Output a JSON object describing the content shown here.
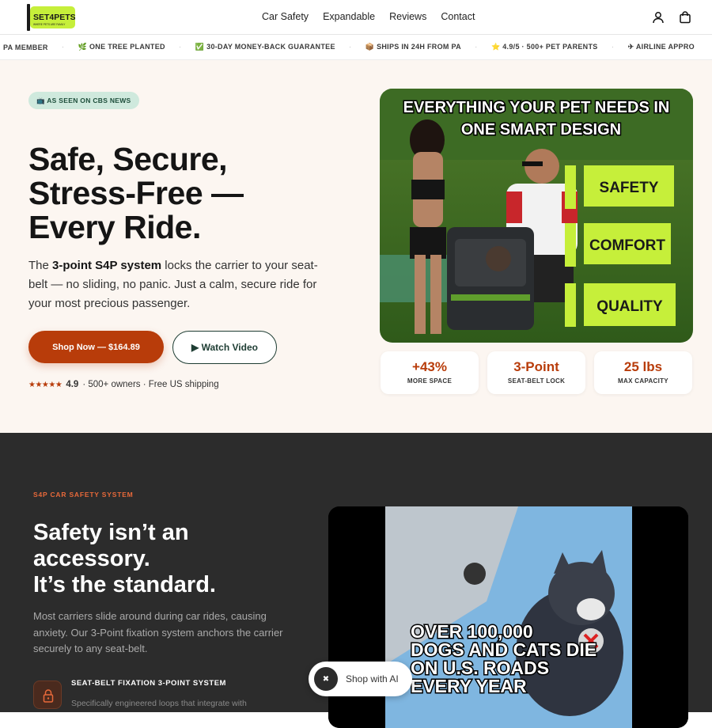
{
  "header": {
    "logo_text": "SET4PETS",
    "logo_tagline": "WHERE PETS ARE FAMILY",
    "nav": [
      "Car Safety",
      "Expandable",
      "Reviews",
      "Contact"
    ],
    "account_icon": "user-icon",
    "cart_icon": "bag-icon"
  },
  "ticker": [
    "PA MEMBER",
    "🌿 ONE TREE PLANTED",
    "✅ 30-DAY MONEY-BACK GUARANTEE",
    "📦 SHIPS IN 24H FROM PA",
    "⭐ 4.9/5 · 500+ PET PARENTS",
    "✈ AIRLINE APPRO"
  ],
  "hero": {
    "badge": "📺 AS SEEN ON CBS NEWS",
    "headline_1": "Safe, Secure,",
    "headline_2": "Stress-Free —",
    "headline_3": "Every Ride.",
    "lead_bold": "3-point S4P system",
    "lead_pre": "The ",
    "lead_post": " locks the carrier to your seat-belt — no sliding, no panic. Just a calm, secure ride for your most precious passenger.",
    "shop_button": "Shop Now — $164.89",
    "video_button": "▶ Watch Video",
    "stars": "★★★★★",
    "rating_value": "4.9",
    "rating_text": "· 500+ owners · Free US shipping",
    "image_caption_1": "EVERYTHING YOUR PET NEEDS IN",
    "image_caption_2": "ONE SMART DESIGN",
    "image_tags": [
      "SAFETY",
      "COMFORT",
      "QUALITY"
    ],
    "stats": [
      {
        "value": "+43%",
        "label": "MORE SPACE"
      },
      {
        "value": "3-Point",
        "label": "SEAT-BELT LOCK"
      },
      {
        "value": "25 lbs",
        "label": "MAX CAPACITY"
      }
    ]
  },
  "dark": {
    "eyebrow": "S4P CAR SAFETY SYSTEM",
    "headline_1": "Safety isn’t an",
    "headline_2": "accessory.",
    "headline_3": "It’s the standard.",
    "paragraph": "Most carriers slide around during car rides, causing anxiety. Our 3-Point fixation system anchors the carrier securely to any seat-belt.",
    "feature_title": "SEAT-BELT FIXATION 3-POINT SYSTEM",
    "feature_desc": "Specifically engineered loops that integrate with",
    "video_caption": [
      "OVER 100,000",
      "DOGS AND  CATS DIE",
      "ON U.S. ROADS",
      "EVERY YEAR"
    ]
  },
  "shop_ai": {
    "label": "Shop with AI"
  },
  "colors": {
    "accent": "#b83c0a",
    "hero_bg": "#fcf6f1",
    "dark_bg": "#2c2c2c",
    "lime": "#c6ef3a",
    "badge_bg": "#cfe9dd"
  }
}
